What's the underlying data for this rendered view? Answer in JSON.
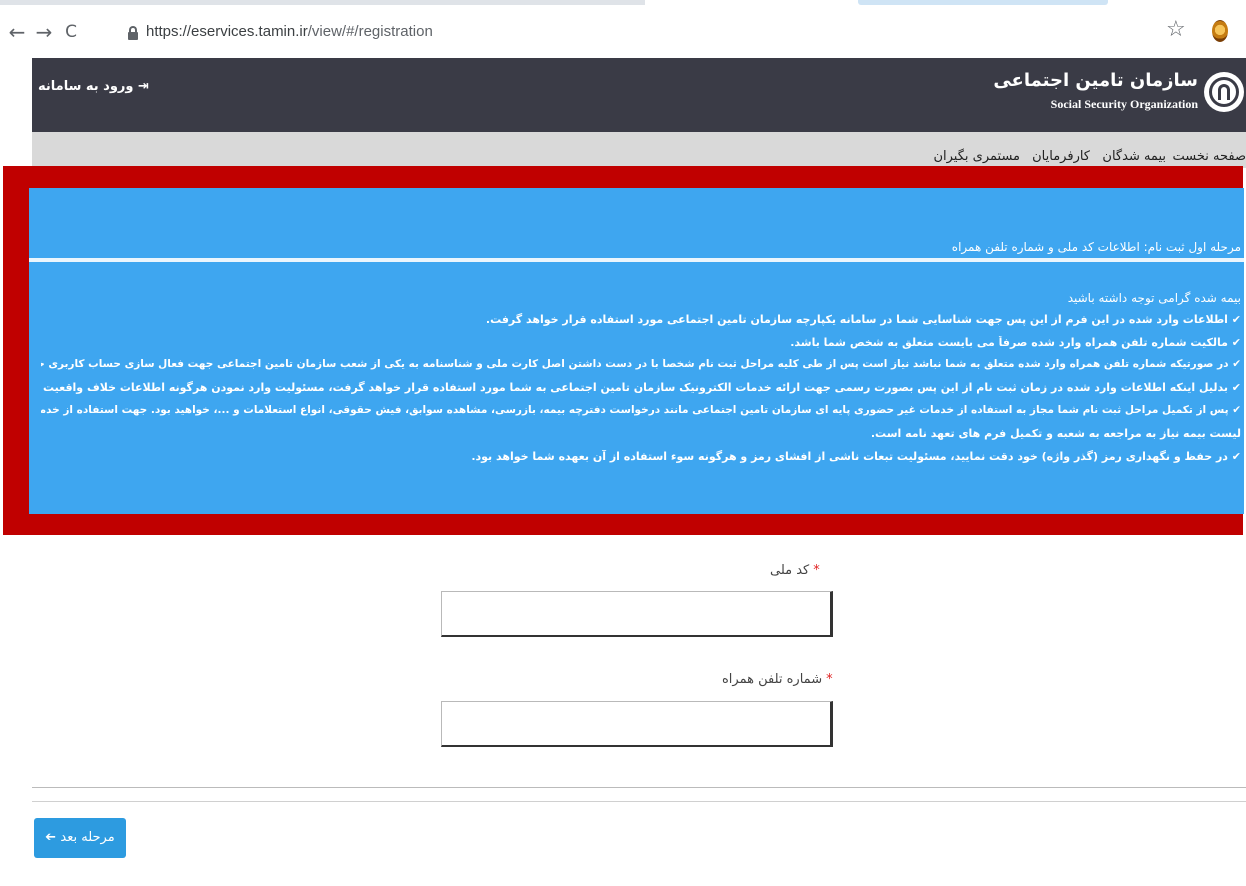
{
  "browser": {
    "url_scheme": "https://",
    "url_host": "eservices.tamin.ir",
    "url_path": "/view/#/registration",
    "back_glyph": "←",
    "forward_glyph": "→",
    "reload_glyph": "C",
    "star_glyph": "☆"
  },
  "header": {
    "login_label": "ورود به سامانه",
    "login_icon_glyph": "⇥",
    "logo_text_fa": "سازمان تامین اجتماعی",
    "logo_text_en": "Social Security Organization"
  },
  "nav": {
    "items": [
      "صفحه نخست",
      "بیمه شدگان",
      "کارفرمایان",
      "مستمری بگیران"
    ]
  },
  "step": {
    "title": "مرحله اول ثبت نام: اطلاعات کد ملی و شماره تلفن همراه"
  },
  "notice": {
    "heading": "بیمه شده گرامی توجه داشته باشید",
    "lines": [
      "✔ اطلاعات وارد شده در این فرم از این پس جهت شناسایی شما در سامانه یکپارچه سازمان تامین اجتماعی مورد استفاده قرار خواهد گرفت.",
      "✔ مالکیت شماره تلفن همراه وارد شده صرفاً می بایست متعلق به شخص شما باشد.",
      "✔ در صورتیکه شماره تلفن همراه وارد شده متعلق به شما نباشد نیاز است پس از طی کلیه مراحل ثبت نام شخصاً با در دست داشتن اصل کارت ملی و شناسنامه به یکی از شعب سازمان تامین اجتماعی جهت فعال سازی حساب کاربری خود مراجعه نمائید.",
      "✔ بدلیل اینکه اطلاعات وارد شده در زمان ثبت نام از این پس بصورت رسمی جهت ارائه خدمات الکترونیک سازمان تامین اجتماعی به شما مورد استفاده قرار خواهد گرفت، مسئولیت وارد نمودن هرگونه اطلاعات خلاف واقعیت بعهده شخص شما خواهد بود.",
      "✔ پس از تکمیل مراحل ثبت نام شما مجاز به استفاده از خدمات غیر حضوری پایه ای سازمان تامین اجتماعی مانند درخواست دفترچه بیمه، بازرسی، مشاهده سوابق، فیش حقوقی، انواع استعلامات و ...، خواهید بود. جهت استفاده از خدمات حقوقی این سامانه مانند ارسال",
      "لیست بیمه نیاز به مراجعه به شعبه و تکمیل فرم های تعهد نامه است.",
      "✔ در حفظ و نگهداری رمز (گذر واژه) خود دقت نمایید، مسئولیت تبعات ناشی از افشای رمز و هرگونه سوء استفاده از آن بعهده شما خواهد بود."
    ]
  },
  "form": {
    "national_code_label": "کد ملی",
    "mobile_label": "شماره تلفن همراه",
    "required_mark": "*",
    "national_code_value": "",
    "mobile_value": ""
  },
  "actions": {
    "next_label": "مرحله بعد",
    "next_icon_glyph": "➔"
  },
  "colors": {
    "header_bg": "#3a3b46",
    "nav_bg": "#d9d9d9",
    "notice_bg": "#3ea6f0",
    "highlight_border": "#c00000",
    "button_bg": "#2d9be0"
  }
}
